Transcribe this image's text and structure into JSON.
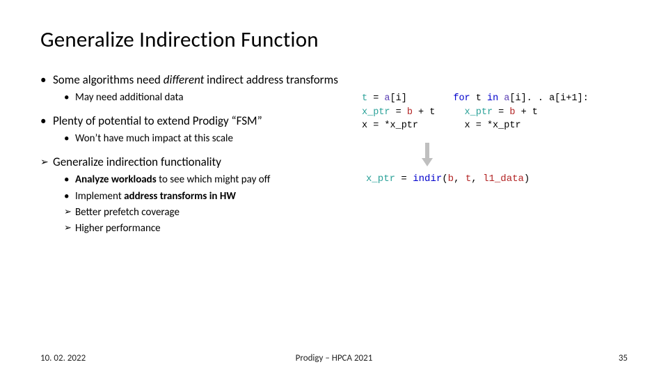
{
  "title": "Generalize Indirection Function",
  "bullets": {
    "b1": {
      "pre": "Some algorithms need ",
      "em": "different",
      "post": " indirect address transforms"
    },
    "b1a": "May need additional data",
    "b2": "Plenty of potential to extend Prodigy “FSM”",
    "b2a": "Won’t have much impact at this scale",
    "b3": "Generalize indirection functionality",
    "b3a": {
      "pre": "Analyze workloads",
      "post": " to see which might pay off"
    },
    "b3b": {
      "pre": "Implement ",
      "mid": "address transforms in HW"
    },
    "b3c": "Better prefetch coverage",
    "b3d": "Higher performance"
  },
  "code": {
    "left": {
      "l1": {
        "t": "t",
        "eq": " = ",
        "a": "a",
        "idx": "[i]"
      },
      "l2": {
        "xp": "x_ptr",
        "eq": " = ",
        "b": "b",
        "plus": " + t"
      },
      "l3": "x = *x_ptr"
    },
    "right": {
      "l1": {
        "for": "for",
        "t": " t ",
        "in": "in",
        "a": " a",
        "range": "[i]. . a[i+1]:"
      },
      "l2": {
        "pad": "  ",
        "xp": "x_ptr",
        "eq": " = ",
        "b": "b",
        "plus": " + t"
      },
      "l3": "  x = *x_ptr"
    },
    "result": {
      "xp": "x_ptr",
      "eq": " = ",
      "fn": "indir",
      "open": "(",
      "a1": "b",
      "c1": ", ",
      "a2": "t",
      "c2": ", ",
      "a3": "l1_data",
      "close": ")"
    }
  },
  "footer": {
    "date": "10. 02. 2022",
    "center": "Prodigy – HPCA 2021",
    "page": "35"
  }
}
